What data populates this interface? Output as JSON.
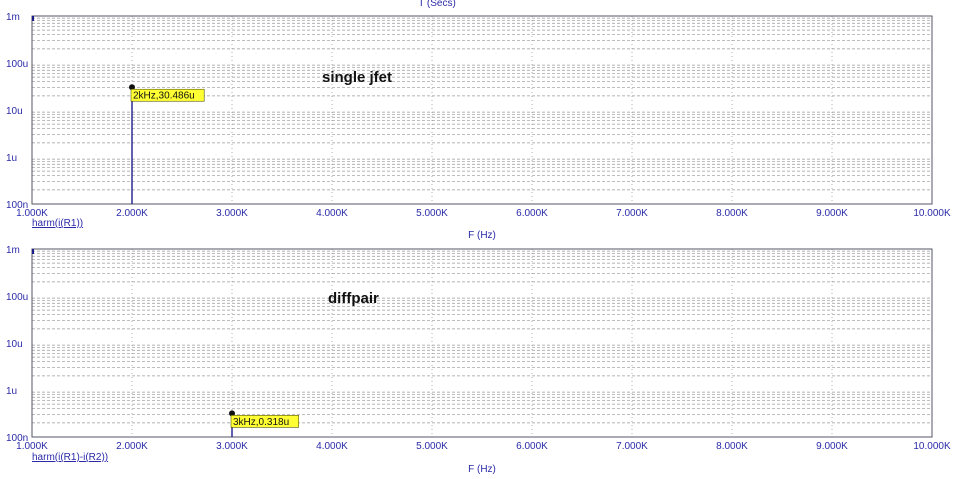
{
  "top_caption": "T (Secs)",
  "colors": {
    "axis": "#2a2aa8",
    "plot_border": "#555566",
    "grid": "#444444",
    "trace": "#1d1d8c",
    "marker_bg": "#ffff33",
    "marker_border": "#555500"
  },
  "chart_data": [
    {
      "type": "bar",
      "title": "",
      "annotation": "single jfet",
      "trace_name": "harm(i(R1))",
      "xlabel": "F (Hz)",
      "x_ticks": [
        "1.000K",
        "2.000K",
        "3.000K",
        "4.000K",
        "5.000K",
        "6.000K",
        "7.000K",
        "8.000K",
        "9.000K",
        "10.000K"
      ],
      "y_ticks": [
        "1m",
        "100u",
        "10u",
        "1u",
        "100n"
      ],
      "y_scale": "log",
      "xlim": [
        1000,
        10000
      ],
      "ylim": [
        1e-07,
        0.001
      ],
      "grid": true,
      "x": [
        2000
      ],
      "values": [
        3.0486e-05
      ],
      "marker_label": "2kHz,30.486u"
    },
    {
      "type": "bar",
      "title": "",
      "annotation": "diffpair",
      "trace_name": "harm(i(R1)-i(R2))",
      "xlabel": "F (Hz)",
      "x_ticks": [
        "1.000K",
        "2.000K",
        "3.000K",
        "4.000K",
        "5.000K",
        "6.000K",
        "7.000K",
        "8.000K",
        "9.000K",
        "10.000K"
      ],
      "y_ticks": [
        "1m",
        "100u",
        "10u",
        "1u",
        "100n"
      ],
      "y_scale": "log",
      "xlim": [
        1000,
        10000
      ],
      "ylim": [
        1e-07,
        0.001
      ],
      "grid": true,
      "x": [
        3000
      ],
      "values": [
        3.18e-07
      ],
      "marker_label": "3kHz,0.318u"
    }
  ]
}
